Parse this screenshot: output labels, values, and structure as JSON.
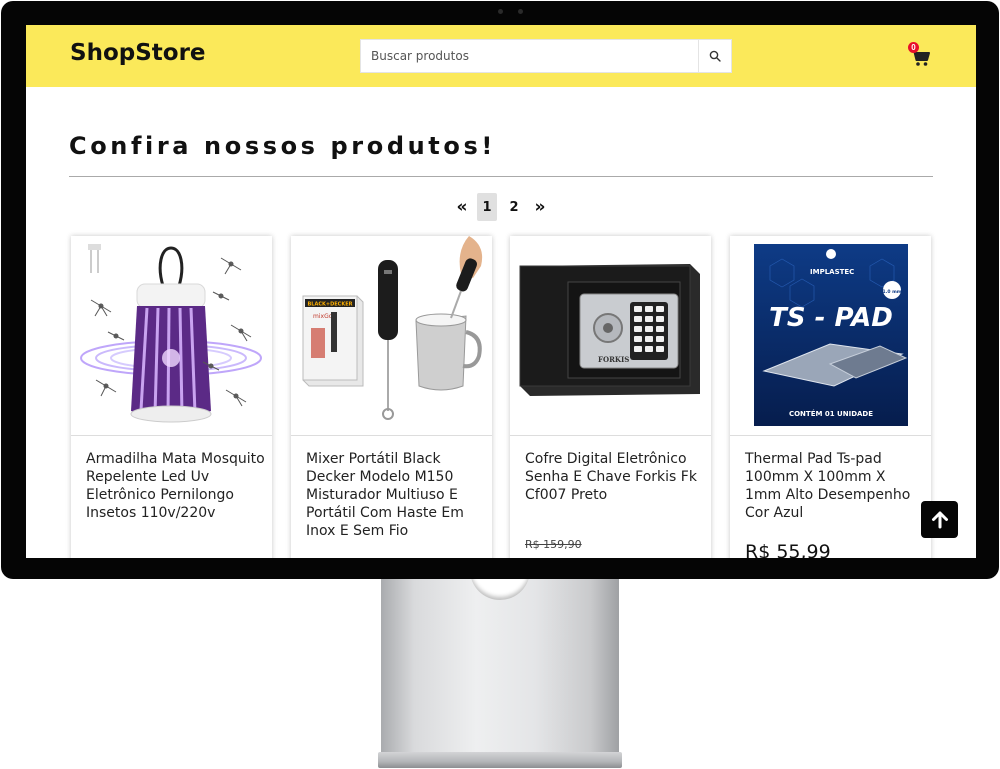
{
  "header": {
    "logo": "ShopStore",
    "search_placeholder": "Buscar produtos",
    "cart_count": "0",
    "accent_color": "#fbe95a"
  },
  "main": {
    "title": "Confira nossos produtos!",
    "pagination": {
      "prev": "«",
      "pages": [
        "1",
        "2"
      ],
      "current": "1",
      "next": "»"
    },
    "products": [
      {
        "title": "Armadilha Mata Mosquito Repelente Led Uv Eletrônico Pernilongo Insetos 110v/220v",
        "old_price": "",
        "price": "",
        "image": "mosquito-lamp-image"
      },
      {
        "title": "Mixer Portátil Black Decker Modelo M150 Misturador Multiuso E Portátil Com Haste Em Inox E Sem Fio",
        "old_price": "",
        "price": "",
        "image": "milk-frother-image"
      },
      {
        "title": "Cofre Digital Eletrônico Senha E Chave Forkis Fk Cf007 Preto",
        "old_price": "R$ 159,90",
        "price": "",
        "image": "digital-safe-image"
      },
      {
        "title": "Thermal Pad Ts-pad 100mm X 100mm X 1mm Alto Desempenho Cor Azul",
        "old_price": "",
        "price": "R$ 55,99",
        "image": "thermal-pad-image"
      }
    ]
  },
  "image_labels": {
    "mixer_box_brand": "BLACK+DECKER",
    "mixer_box_sub": "mixGo",
    "safe_brand": "FORKIS",
    "thermal_brand": "IMPLASTEC",
    "thermal_name": "TS - PAD",
    "thermal_badge": "1.0 mm",
    "thermal_footer": "CONTÉM 01 UNIDADE"
  },
  "icons": [
    "search-icon",
    "cart-icon",
    "arrow-up-icon"
  ]
}
